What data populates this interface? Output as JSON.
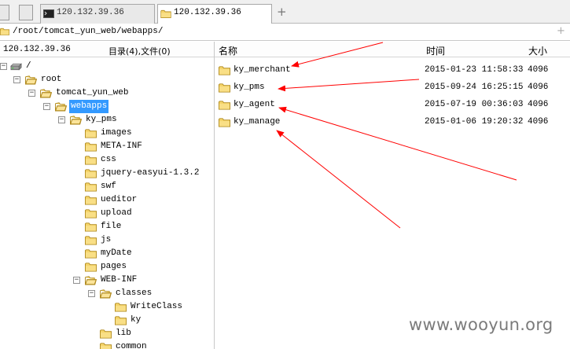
{
  "tabs": [
    {
      "label": "120.132.39.36",
      "active": false
    },
    {
      "label": "120.132.39.36",
      "active": true
    }
  ],
  "path_bar": {
    "value": "/root/tomcat_yun_web/webapps/"
  },
  "left_pane": {
    "host": "120.132.39.36",
    "counts": "目录(4),文件(0)"
  },
  "tree": [
    {
      "label": "/",
      "kind": "drive"
    },
    {
      "label": "root",
      "kind": "folder"
    },
    {
      "label": "tomcat_yun_web",
      "kind": "folder"
    },
    {
      "label": "webapps",
      "kind": "folder",
      "selected": true
    },
    {
      "label": "ky_pms",
      "kind": "folder"
    },
    {
      "label": "images",
      "kind": "folder"
    },
    {
      "label": "META-INF",
      "kind": "folder"
    },
    {
      "label": "css",
      "kind": "folder"
    },
    {
      "label": "jquery-easyui-1.3.2",
      "kind": "folder"
    },
    {
      "label": "swf",
      "kind": "folder"
    },
    {
      "label": "ueditor",
      "kind": "folder"
    },
    {
      "label": "upload",
      "kind": "folder"
    },
    {
      "label": "file",
      "kind": "folder"
    },
    {
      "label": "js",
      "kind": "folder"
    },
    {
      "label": "myDate",
      "kind": "folder"
    },
    {
      "label": "pages",
      "kind": "folder"
    },
    {
      "label": "WEB-INF",
      "kind": "folder"
    },
    {
      "label": "classes",
      "kind": "folder"
    },
    {
      "label": "WriteClass",
      "kind": "folder"
    },
    {
      "label": "ky",
      "kind": "folder"
    },
    {
      "label": "lib",
      "kind": "folder"
    },
    {
      "label": "common",
      "kind": "folder"
    }
  ],
  "columns": {
    "name": "名称",
    "time": "时间",
    "size": "大小"
  },
  "files": [
    {
      "name": "ky_merchant",
      "time": "2015-01-23 11:58:33",
      "size": "4096"
    },
    {
      "name": "ky_pms",
      "time": "2015-09-24 16:25:15",
      "size": "4096"
    },
    {
      "name": "ky_agent",
      "time": "2015-07-19 00:36:03",
      "size": "4096"
    },
    {
      "name": "ky_manage",
      "time": "2015-01-06 19:20:32",
      "size": "4096"
    }
  ],
  "watermark": "www.wooyun.org",
  "colors": {
    "selection": "#3399ff",
    "annotation_arrow": "#ff0000",
    "folder": "#f2c94c"
  }
}
